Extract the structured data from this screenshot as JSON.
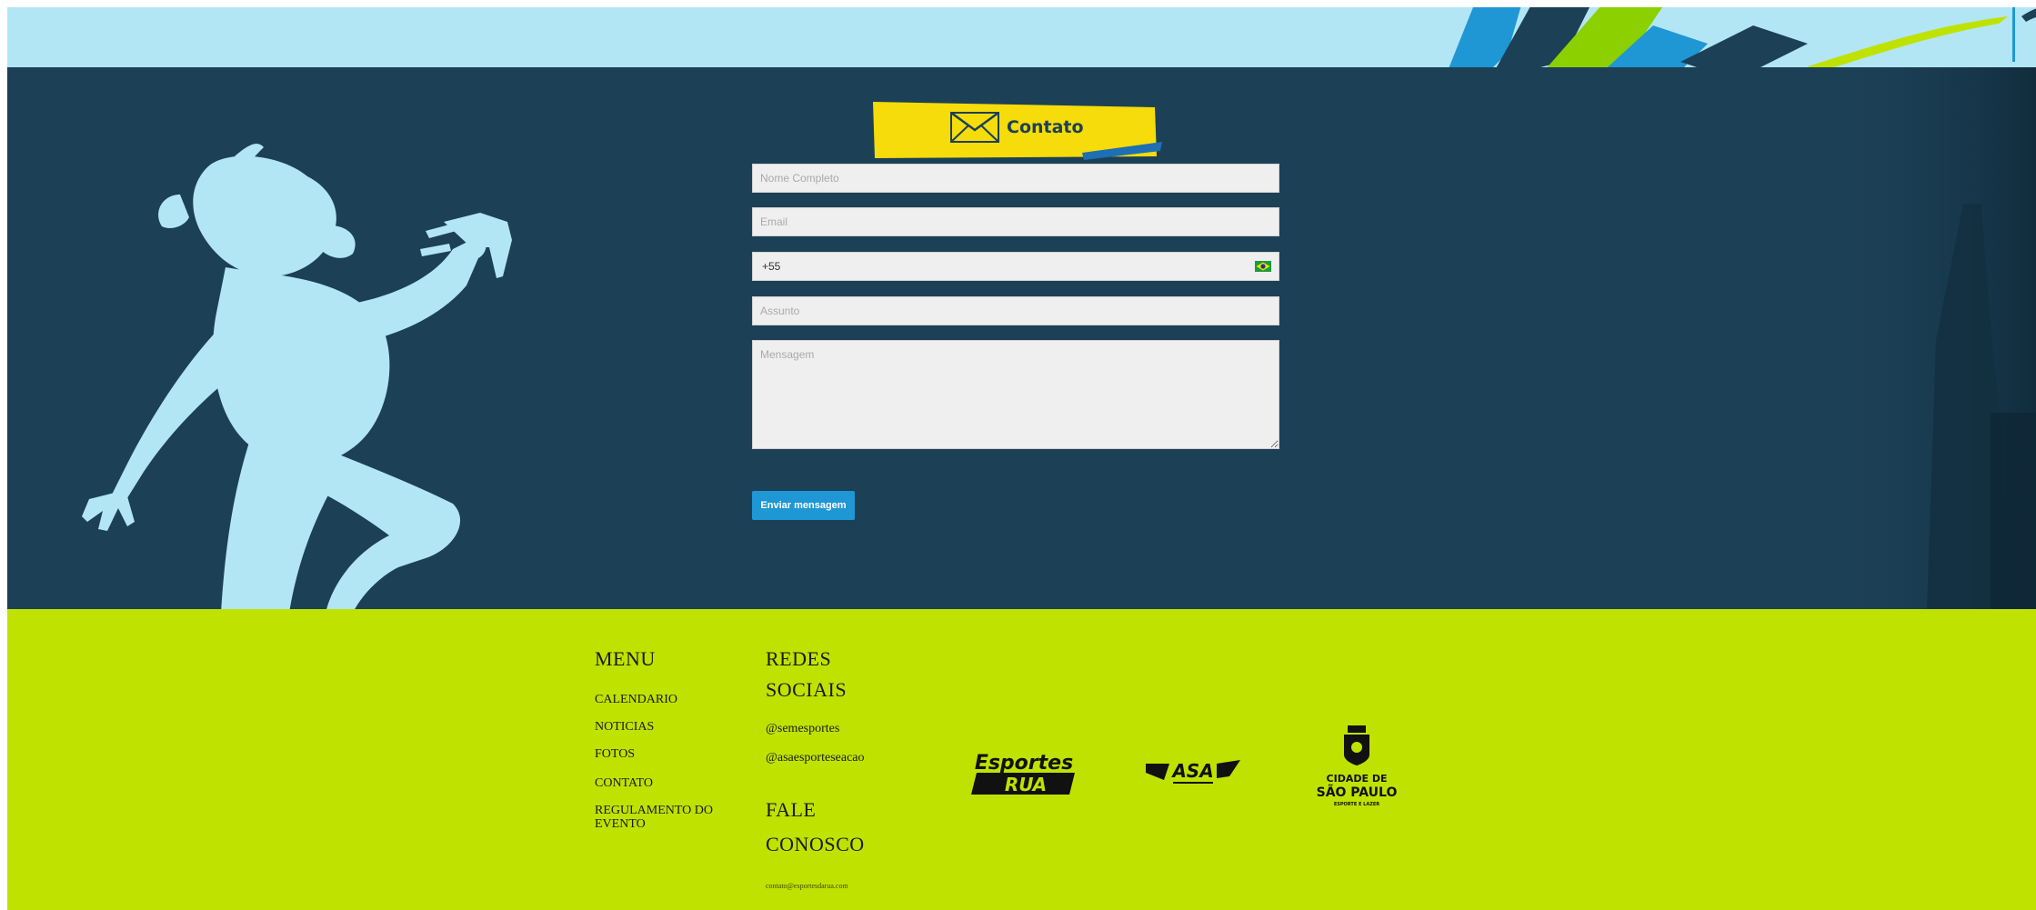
{
  "contact": {
    "badge_label": "Contato",
    "form": {
      "name_placeholder": "Nome Completo",
      "email_placeholder": "Email",
      "phone_value": "+55",
      "subject_placeholder": "Assunto",
      "message_placeholder": "Mensagem",
      "submit_label": "Enviar mensagem"
    },
    "colors": {
      "background": "#1c4056",
      "badge": "#f5dc0a",
      "button": "#1e97d4",
      "silhouette": "#b2e6f4"
    },
    "icons": [
      "envelope-icon",
      "brazil-flag-icon"
    ]
  },
  "footer": {
    "background": "#c0e200",
    "menu": {
      "heading": "MENU",
      "items": [
        "CALENDARIO",
        "NOTICIAS",
        "FOTOS",
        "CONTATO",
        "REGULAMENTO DO EVENTO"
      ]
    },
    "social": {
      "heading_line1": "REDES",
      "heading_line2": "SOCIAIS",
      "handles": [
        "@semesportes",
        "@asaesporteseacao"
      ]
    },
    "contact": {
      "heading_line1": "FALE",
      "heading_line2": "CONOSCO",
      "email": "contato@esportesdarua.com"
    },
    "logos": {
      "esportes_line1": "Esportes",
      "esportes_line2": "RUA",
      "asa": "ASA",
      "city_line1": "CIDADE DE",
      "city_line2": "SÃO PAULO",
      "city_line3": "ESPORTE E LAZER"
    }
  }
}
